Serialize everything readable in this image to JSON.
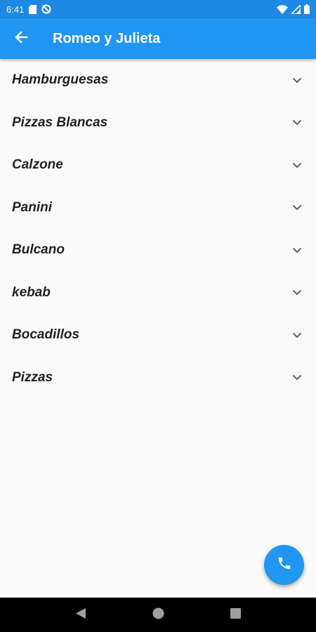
{
  "status_bar": {
    "time": "6:41",
    "icons": [
      "sd-card-icon",
      "sync-off-icon",
      "wifi-icon",
      "signal-icon",
      "battery-icon"
    ]
  },
  "app_bar": {
    "title": "Romeo y Julieta",
    "back_icon": "arrow-back-icon"
  },
  "menu": {
    "items": [
      {
        "label": "Hamburguesas"
      },
      {
        "label": "Pizzas Blancas"
      },
      {
        "label": "Calzone"
      },
      {
        "label": "Panini"
      },
      {
        "label": "Bulcano"
      },
      {
        "label": "kebab"
      },
      {
        "label": "Bocadillos"
      },
      {
        "label": "Pizzas"
      }
    ],
    "expand_icon": "chevron-down-icon"
  },
  "fab": {
    "icon": "phone-icon"
  },
  "nav_bar": {
    "icons": [
      "back-triangle-icon",
      "home-circle-icon",
      "recents-square-icon"
    ]
  },
  "colors": {
    "status_bar": "#1e88e5",
    "app_bar": "#2196f3",
    "background": "#fafafa",
    "text": "#222222",
    "chevron": "#616161",
    "fab": "#2196f3",
    "nav_bar": "#000000"
  }
}
